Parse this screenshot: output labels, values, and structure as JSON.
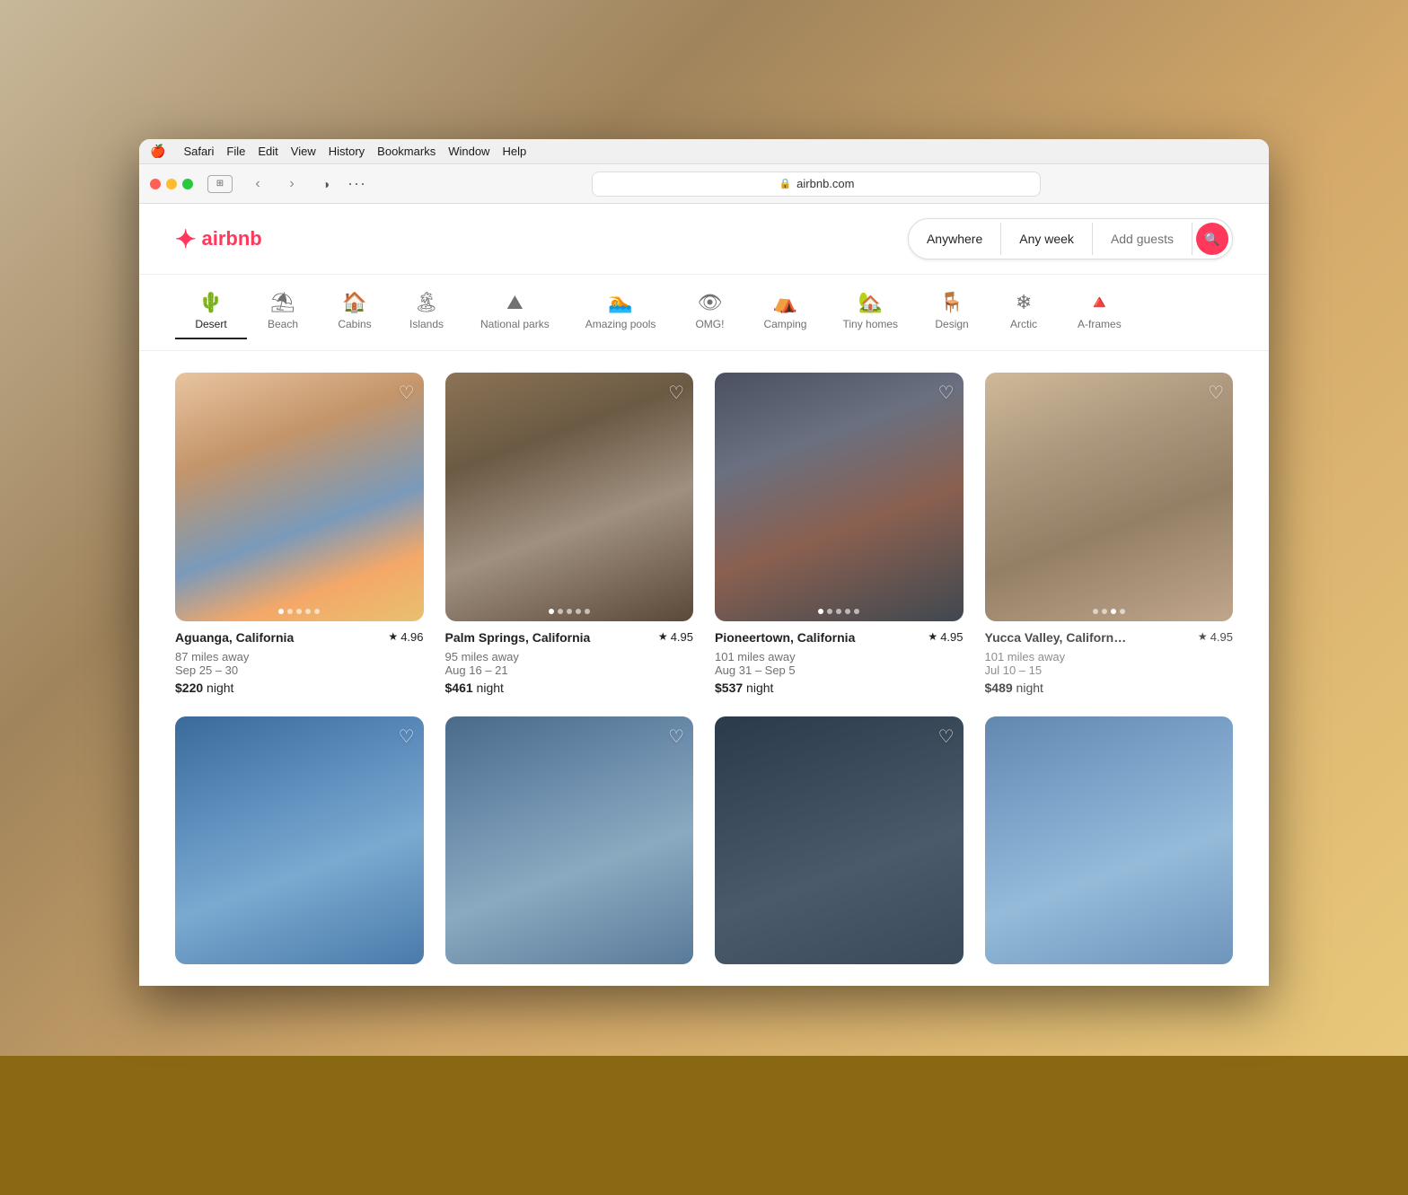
{
  "macos": {
    "menu_items": [
      "Safari",
      "File",
      "Edit",
      "View",
      "History",
      "Bookmarks",
      "Window",
      "Help"
    ],
    "url": "airbnb.com"
  },
  "airbnb": {
    "logo_text": "airbnb",
    "search": {
      "anywhere": "Anywhere",
      "any_week": "Any week",
      "add_guests": "Add guests"
    },
    "categories": [
      {
        "id": "desert",
        "label": "Desert",
        "icon": "🌵"
      },
      {
        "id": "beach",
        "label": "Beach",
        "icon": "⛱"
      },
      {
        "id": "cabins",
        "label": "Cabins",
        "icon": "🏠"
      },
      {
        "id": "islands",
        "label": "Islands",
        "icon": "🏝"
      },
      {
        "id": "national_parks",
        "label": "National parks",
        "icon": "⛰"
      },
      {
        "id": "amazing_pools",
        "label": "Amazing pools",
        "icon": "🏊"
      },
      {
        "id": "omg",
        "label": "OMG!",
        "icon": "👁"
      },
      {
        "id": "camping",
        "label": "Camping",
        "icon": "⛺"
      },
      {
        "id": "tiny_homes",
        "label": "Tiny homes",
        "icon": "🏡"
      },
      {
        "id": "design",
        "label": "Design",
        "icon": "🪑"
      },
      {
        "id": "arctic",
        "label": "Arctic",
        "icon": "❄"
      },
      {
        "id": "aframes",
        "label": "A-frames",
        "icon": "🔺"
      }
    ],
    "listings": [
      {
        "id": 1,
        "location": "Aguanga, California",
        "rating": "4.96",
        "distance": "87 miles away",
        "dates": "Sep 25 – 30",
        "price": "$220",
        "price_unit": "night",
        "img_class": "img-aguanga",
        "dots": 5,
        "active_dot": 0
      },
      {
        "id": 2,
        "location": "Palm Springs, California",
        "rating": "4.95",
        "distance": "95 miles away",
        "dates": "Aug 16 – 21",
        "price": "$461",
        "price_unit": "night",
        "img_class": "img-palmsprings",
        "dots": 5,
        "active_dot": 0
      },
      {
        "id": 3,
        "location": "Pioneertown, California",
        "rating": "4.95",
        "distance": "101 miles away",
        "dates": "Aug 31 – Sep 5",
        "price": "$537",
        "price_unit": "night",
        "img_class": "img-pioneertown",
        "dots": 5,
        "active_dot": 0
      },
      {
        "id": 4,
        "location": "Yucca Valley, Californ…",
        "rating": "4.95",
        "distance": "101 miles away",
        "dates": "Jul 10 – 15",
        "price": "$489",
        "price_unit": "night",
        "img_class": "img-yucca",
        "dots": 4,
        "active_dot": 2
      }
    ]
  }
}
